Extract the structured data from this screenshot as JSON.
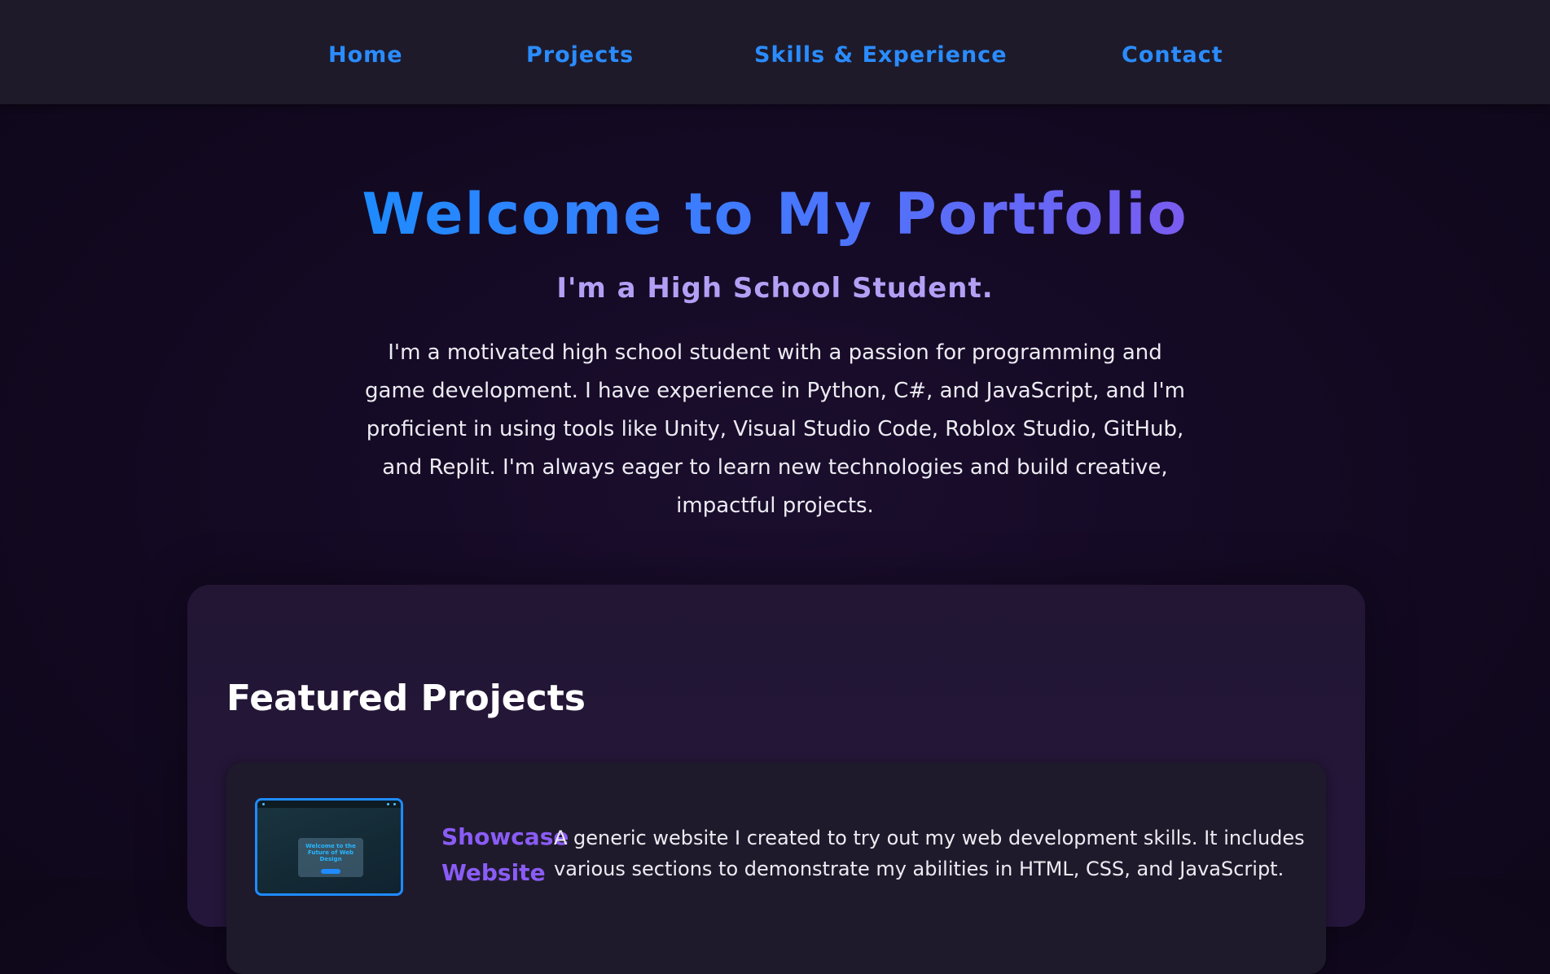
{
  "nav": {
    "items": [
      {
        "label": "Home"
      },
      {
        "label": "Projects"
      },
      {
        "label": "Skills & Experience"
      },
      {
        "label": "Contact"
      }
    ]
  },
  "hero": {
    "title": "Welcome to My Portfolio",
    "subtitle": "I'm a High School Student.",
    "intro": "I'm a motivated high school student with a passion for programming and game development. I have experience in Python, C#, and JavaScript, and I'm proficient in using tools like Unity, Visual Studio Code, Roblox Studio, GitHub, and Replit. I'm always eager to learn new technologies and build creative, impactful projects."
  },
  "projects": {
    "section_title": "Featured Projects",
    "items": [
      {
        "name": "Showcase Website",
        "description": "A generic website I created to try out my web development skills. It includes various sections to demonstrate my abilities in HTML, CSS, and JavaScript.",
        "thumbnail_text": "Welcome to the Future of Web Design"
      }
    ]
  },
  "colors": {
    "nav_link": "#2a8cff",
    "title_gradient_start": "#1e8bff",
    "title_gradient_end": "#7a5cf0",
    "subtitle": "#b3a0f5",
    "project_name": "#8a5cf6",
    "background": "#140a24",
    "navbar_bg": "#1e1a2a"
  }
}
